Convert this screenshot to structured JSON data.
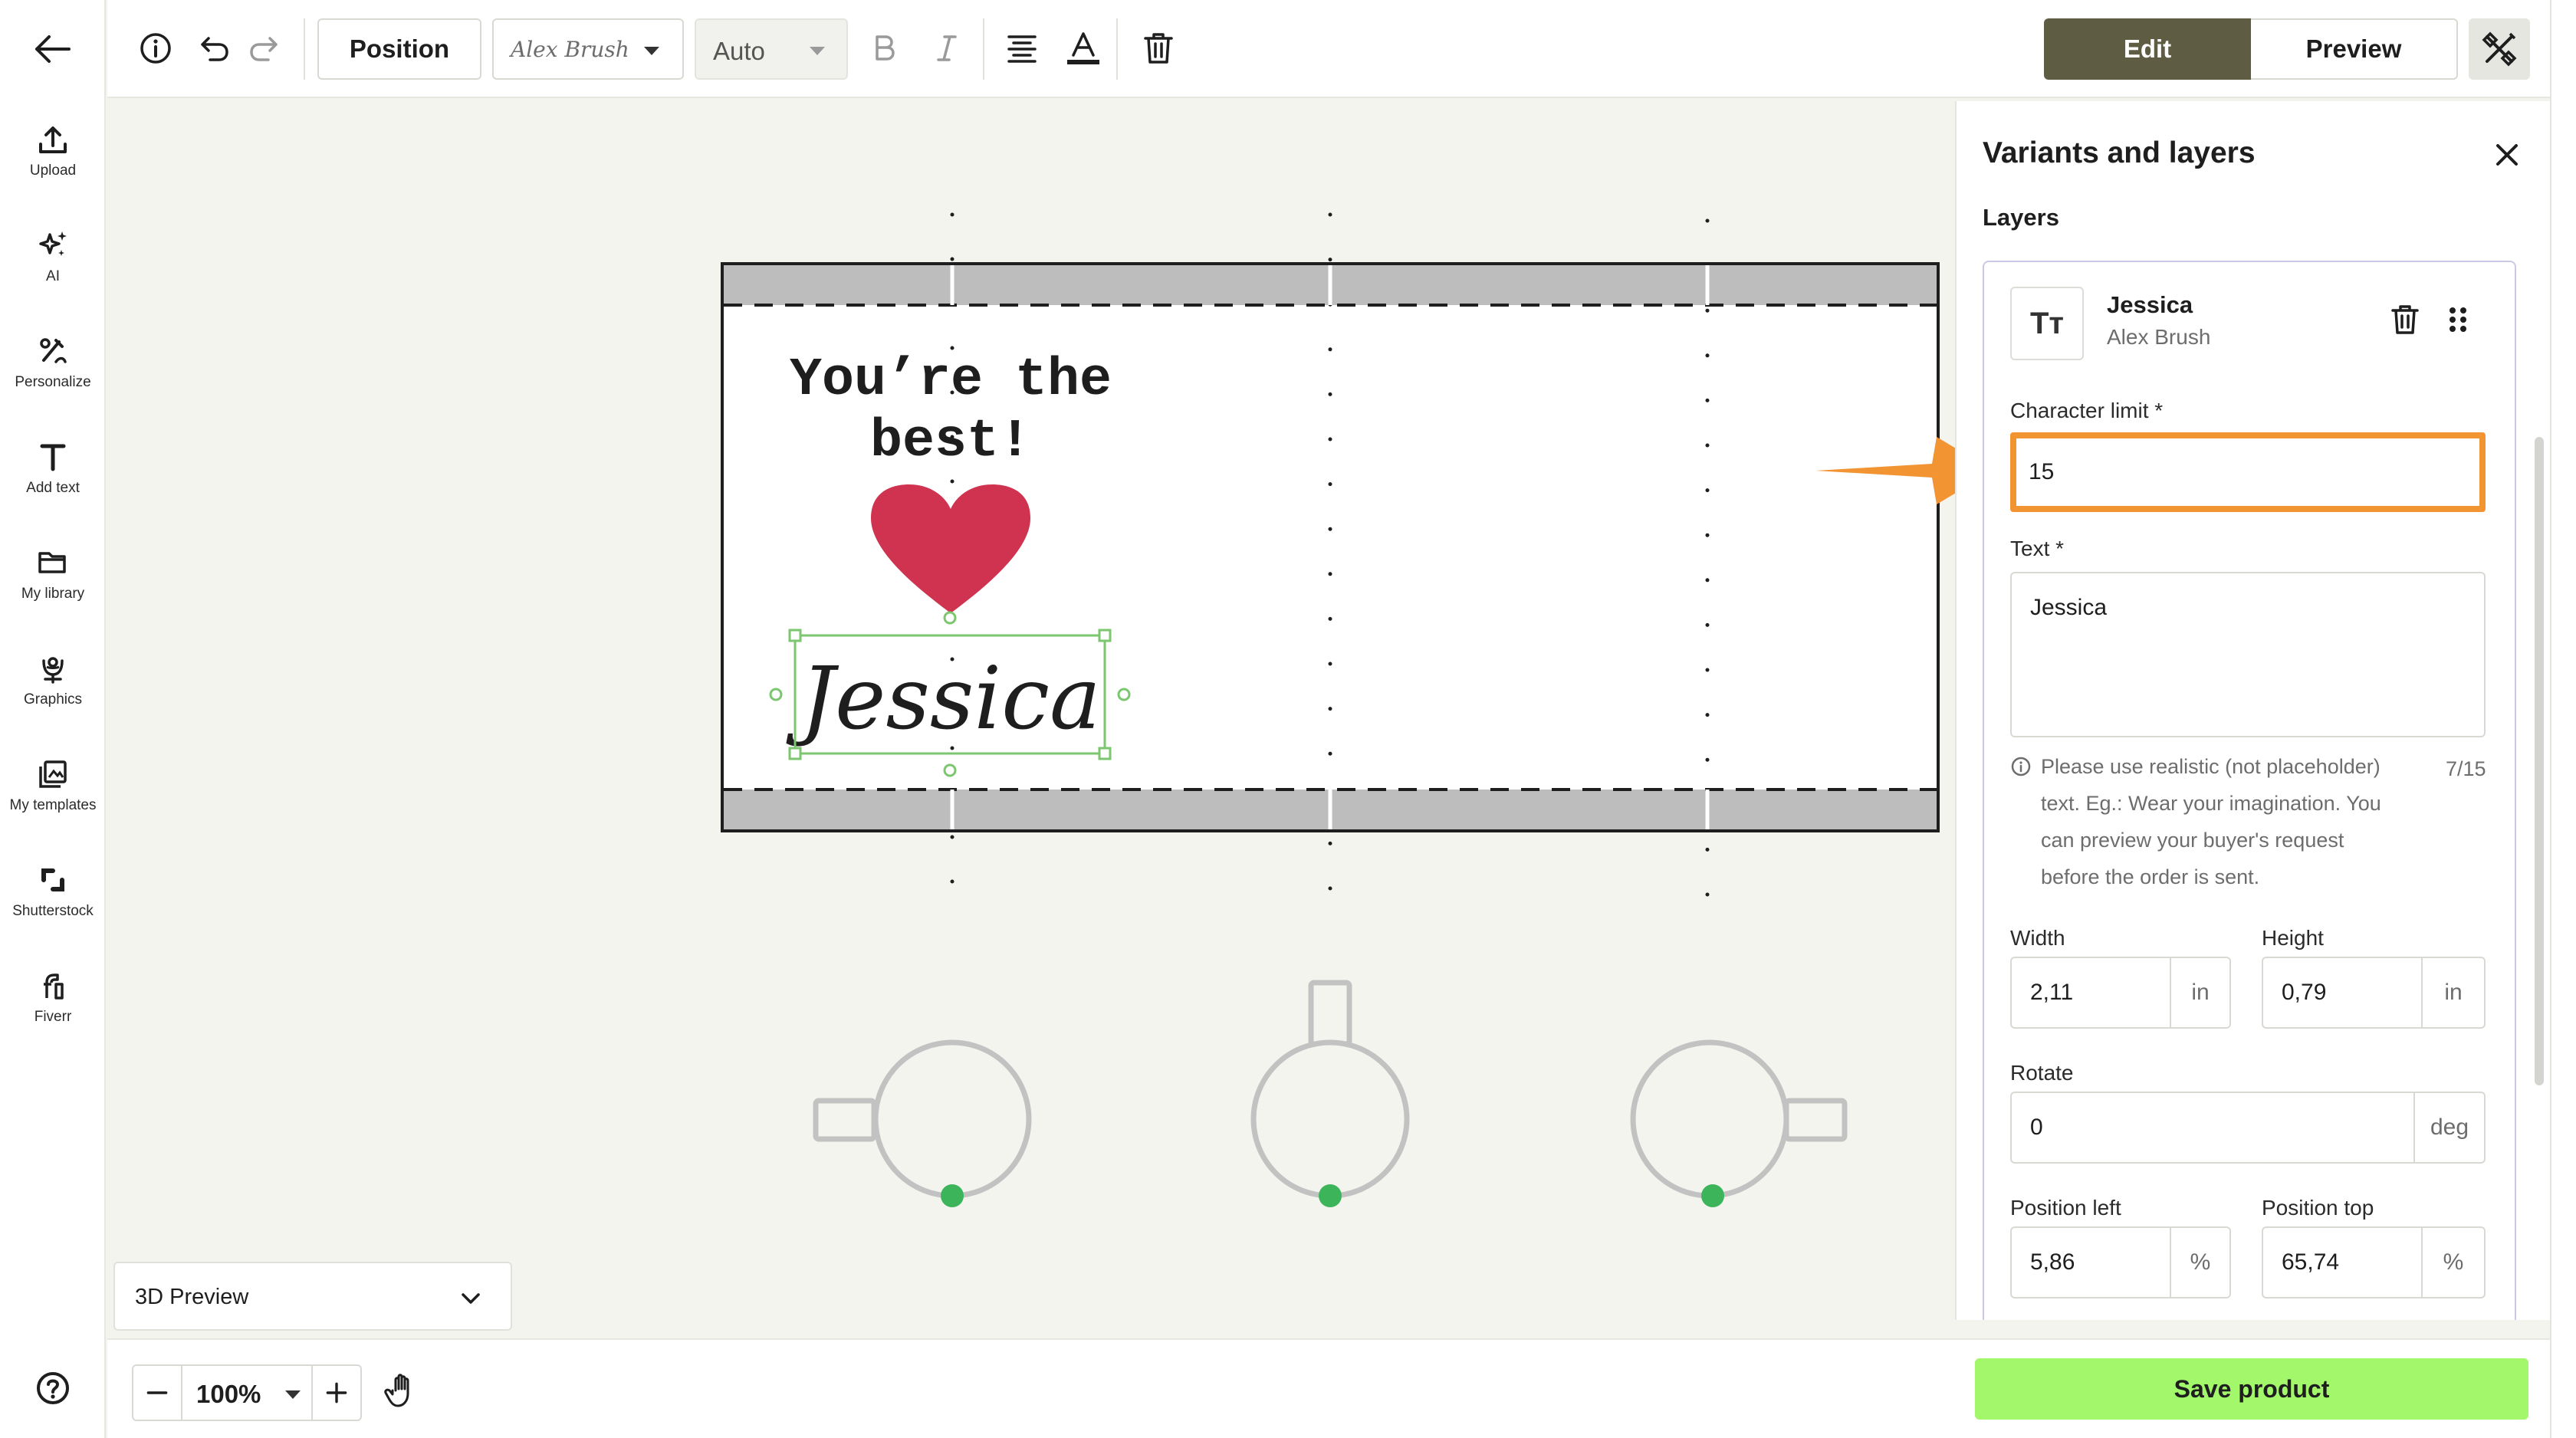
{
  "sidebar": {
    "items": [
      {
        "label": "Upload",
        "icon": "upload-icon"
      },
      {
        "label": "AI",
        "icon": "sparkles-icon"
      },
      {
        "label": "Personalize",
        "icon": "personalize-icon"
      },
      {
        "label": "Add text",
        "icon": "text-icon"
      },
      {
        "label": "My library",
        "icon": "folder-icon"
      },
      {
        "label": "Graphics",
        "icon": "flower-icon"
      },
      {
        "label": "My templates",
        "icon": "templates-icon"
      },
      {
        "label": "Shutterstock",
        "icon": "shutterstock-icon"
      },
      {
        "label": "Fiverr",
        "icon": "fiverr-icon"
      }
    ]
  },
  "toolbar": {
    "position_label": "Position",
    "font_value": "Alex Brush",
    "size_value": "Auto",
    "edit_label": "Edit",
    "preview_label": "Preview"
  },
  "canvas": {
    "headline_line1": "You’re the",
    "headline_line2": "best!",
    "script_text": "Jessica",
    "heart_color": "#cf334f",
    "dot_color": "#3cb55a"
  },
  "panel": {
    "title": "Variants and layers",
    "layers_heading": "Layers",
    "layer": {
      "thumb_text": "Tт",
      "name": "Jessica",
      "font": "Alex Brush"
    },
    "char_limit_label": "Character limit *",
    "char_limit_value": "15",
    "text_label": "Text *",
    "text_value": "Jessica",
    "hint": "Please use realistic (not placeholder) text. Eg.: Wear your imagination. You can preview your buyer's request before the order is sent.",
    "hint_lines": [
      "Please use realistic (not placeholder)",
      "text. Eg.: Wear your imagination. You",
      "can preview your buyer's request",
      "before the order is sent."
    ],
    "char_count": "7/15",
    "width_label": "Width",
    "width_value": "2,11",
    "width_unit": "in",
    "height_label": "Height",
    "height_value": "0,79",
    "height_unit": "in",
    "rotate_label": "Rotate",
    "rotate_value": "0",
    "rotate_unit": "deg",
    "pos_left_label": "Position left",
    "pos_left_value": "5,86",
    "pos_left_unit": "%",
    "pos_top_label": "Position top",
    "pos_top_value": "65,74",
    "pos_top_unit": "%",
    "highlight_color": "#f39433"
  },
  "bottom": {
    "preview_select": "3D Preview",
    "zoom": "100%",
    "save_label": "Save product",
    "save_color": "#a2f76a"
  }
}
